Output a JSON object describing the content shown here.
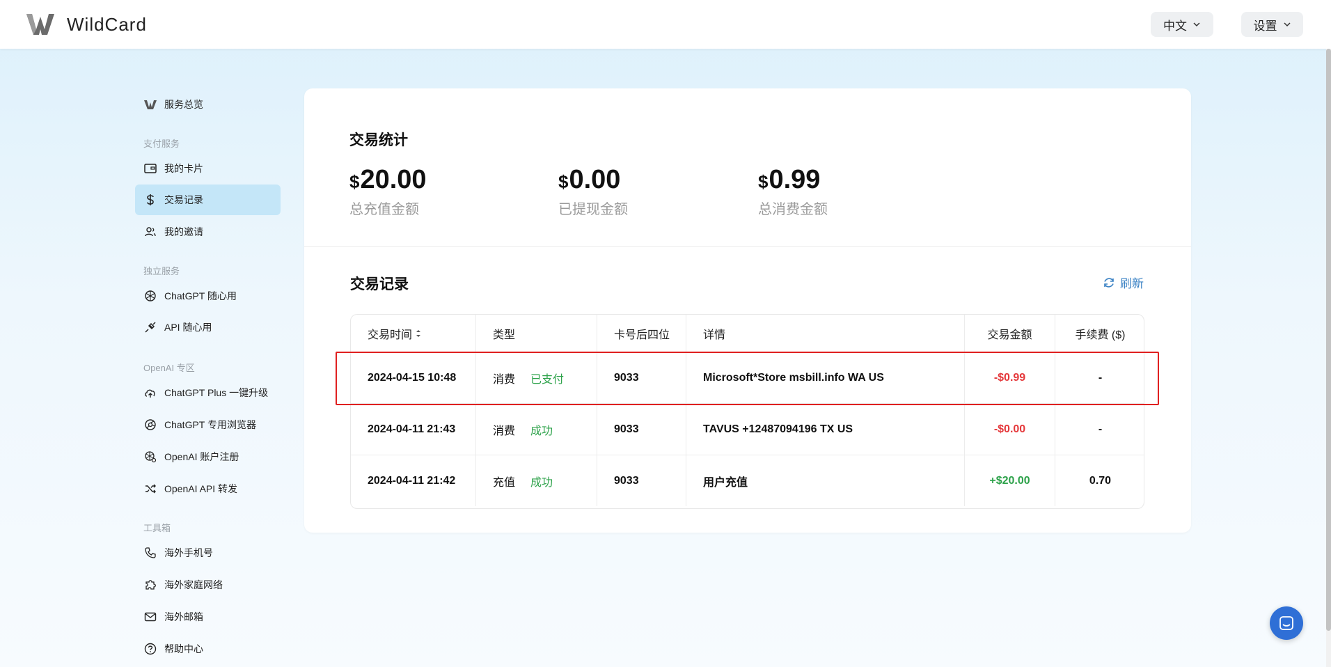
{
  "header": {
    "brand": "WildCard",
    "language_label": "中文",
    "settings_label": "设置"
  },
  "sidebar": {
    "overview": "服务总览",
    "sections": {
      "payment": "支付服务",
      "standalone": "独立服务",
      "openai": "OpenAI 专区",
      "tools": "工具箱"
    },
    "items": [
      {
        "label": "我的卡片",
        "icon": "card-icon"
      },
      {
        "label": "交易记录",
        "icon": "dollar-icon",
        "active": true
      },
      {
        "label": "我的邀请",
        "icon": "users-icon"
      },
      {
        "label": "ChatGPT 随心用",
        "icon": "openai-icon"
      },
      {
        "label": "API 随心用",
        "icon": "plug-icon"
      },
      {
        "label": "ChatGPT Plus 一键升级",
        "icon": "cloud-upload-icon"
      },
      {
        "label": "ChatGPT 专用浏览器",
        "icon": "browser-icon"
      },
      {
        "label": "OpenAI 账户注册",
        "icon": "openai-gear-icon"
      },
      {
        "label": "OpenAI API 转发",
        "icon": "shuffle-icon"
      },
      {
        "label": "海外手机号",
        "icon": "phone-icon"
      },
      {
        "label": "海外家庭网络",
        "icon": "puzzle-icon"
      },
      {
        "label": "海外邮箱",
        "icon": "mail-icon"
      },
      {
        "label": "帮助中心",
        "icon": "help-icon"
      }
    ]
  },
  "stats": {
    "title": "交易统计",
    "items": [
      {
        "currency": "$",
        "value": "20.00",
        "label": "总充值金额"
      },
      {
        "currency": "$",
        "value": "0.00",
        "label": "已提现金额"
      },
      {
        "currency": "$",
        "value": "0.99",
        "label": "总消费金额"
      }
    ]
  },
  "records": {
    "title": "交易记录",
    "refresh_label": "刷新",
    "columns": [
      "交易时间",
      "类型",
      "卡号后四位",
      "详情",
      "交易金额",
      "手续费 ($)"
    ],
    "rows": [
      {
        "time": "2024-04-15 10:48",
        "kind": "消费",
        "status": "已支付",
        "card": "9033",
        "detail": "Microsoft*Store msbill.info WA US",
        "amount": "-$0.99",
        "fee": "-"
      },
      {
        "time": "2024-04-11 21:43",
        "kind": "消费",
        "status": "成功",
        "card": "9033",
        "detail": "TAVUS +12487094196 TX US",
        "amount": "-$0.00",
        "fee": "-"
      },
      {
        "time": "2024-04-11 21:42",
        "kind": "充值",
        "status": "成功",
        "card": "9033",
        "detail": "用户充值",
        "amount": "+$20.00",
        "fee": "0.70"
      }
    ]
  },
  "colors": {
    "accent": "#3b82c4",
    "active_bg": "#c4e6f8",
    "negative": "#e5383b",
    "positive": "#2da24a",
    "highlight": "#e02020"
  }
}
